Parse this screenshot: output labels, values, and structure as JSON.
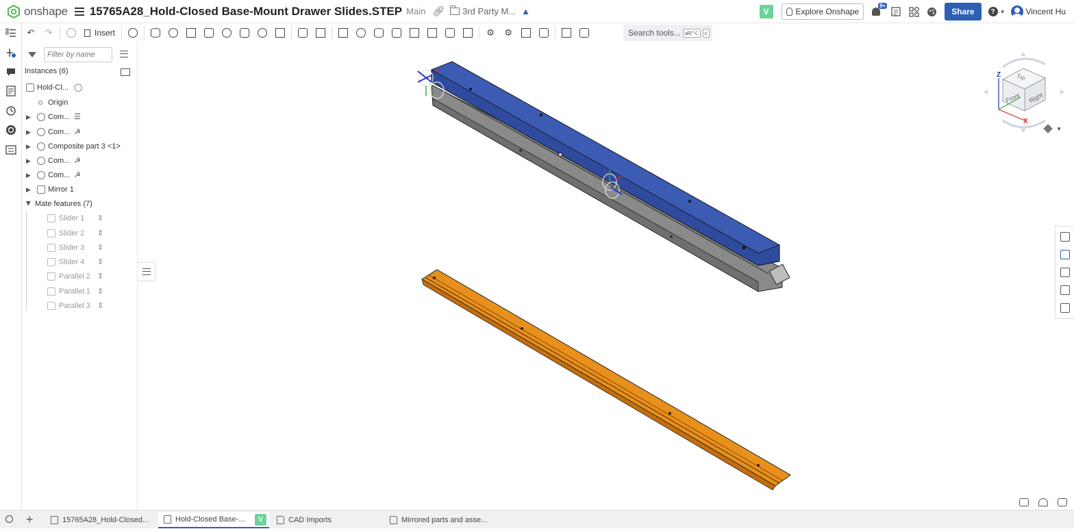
{
  "app": {
    "logo_text": "onshape",
    "document_title": "15765A28_Hold-Closed Base-Mount Drawer Slides.STEP",
    "branch": "Main",
    "folder_crumb": "3rd Party M...",
    "workspace_badge": "V",
    "explore_label": "Explore Onshape",
    "notification_count": "9+",
    "share_label": "Share",
    "help_glyph": "?",
    "user_name": "Vincent Hu",
    "accent_color": "#2d5fb5",
    "badge_color": "#6dd39b"
  },
  "toolbar": {
    "insert_label": "Insert",
    "search_label": "Search tools...",
    "search_shortcut_1": "alt/⌥",
    "search_shortcut_2": "c"
  },
  "panel": {
    "filter_placeholder": "Filter by name",
    "instances_header": "Instances (6)",
    "items": [
      {
        "label": "Hold-Cl...",
        "icon": "part-studio-icon",
        "mate": "fixed-icon"
      },
      {
        "label": "Origin",
        "icon": "origin-icon"
      },
      {
        "label": "Com...",
        "icon": "composite-part-icon",
        "mate": "fixed-stripes-icon"
      },
      {
        "label": "Com...",
        "icon": "composite-part-icon",
        "mate": "mate-connector-icon"
      },
      {
        "label": "Composite part 3 <1>",
        "icon": "composite-part-icon"
      },
      {
        "label": "Com...",
        "icon": "composite-part-icon",
        "mate": "mate-connector-icon"
      },
      {
        "label": "Com...",
        "icon": "composite-part-icon",
        "mate": "mate-connector-icon"
      },
      {
        "label": "Mirror 1",
        "icon": "mirror-icon"
      }
    ],
    "mate_features_header": "Mate features (7)",
    "mates": [
      {
        "label": "Slider 1",
        "icon": "slider-mate-icon"
      },
      {
        "label": "Slider 2",
        "icon": "slider-mate-icon"
      },
      {
        "label": "Slider 3",
        "icon": "slider-mate-icon"
      },
      {
        "label": "Slider 4",
        "icon": "slider-mate-icon"
      },
      {
        "label": "Parallel 2",
        "icon": "parallel-mate-icon"
      },
      {
        "label": "Parallel 1",
        "icon": "parallel-mate-icon"
      },
      {
        "label": "Parallel 3",
        "icon": "parallel-mate-icon"
      }
    ]
  },
  "view_cube": {
    "top": "Top",
    "front": "Front",
    "right": "Right",
    "axis_z": "Z",
    "axis_x": "X"
  },
  "model_colors": {
    "blue_rail": "#2e4b9e",
    "grey_rail": "#8a8a8a",
    "orange_rail": "#e8901c"
  },
  "tabs": [
    {
      "label": "15765A28_Hold-Closed...",
      "icon": "folder-part-icon"
    },
    {
      "label": "Hold-Closed Base-...",
      "icon": "assembly-icon",
      "badge": "V",
      "active": true
    },
    {
      "label": "CAD Imports",
      "icon": "folder-icon"
    },
    {
      "label": "Mirrored parts and asse...",
      "icon": "folder-icon"
    }
  ]
}
